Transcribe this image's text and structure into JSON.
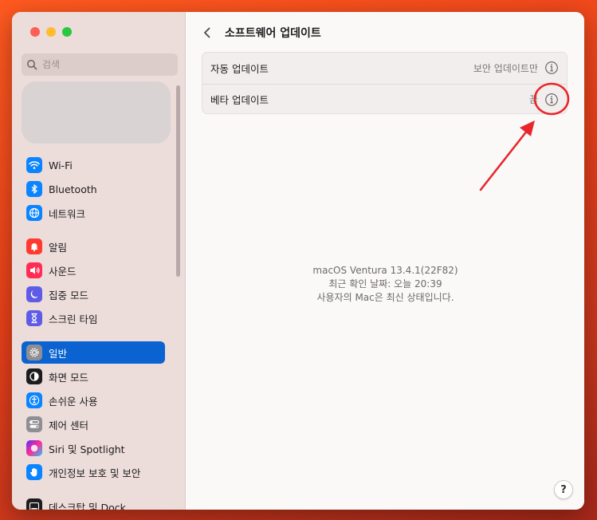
{
  "sidebar": {
    "search_placeholder": "검색",
    "items": [
      {
        "label": "Wi-Fi",
        "icon": "wifi-icon",
        "color": "#0a84ff"
      },
      {
        "label": "Bluetooth",
        "icon": "bluetooth-icon",
        "color": "#0a84ff"
      },
      {
        "label": "네트워크",
        "icon": "globe-icon",
        "color": "#0a84ff"
      },
      {
        "label": "알림",
        "icon": "bell-icon",
        "color": "#ff3b30"
      },
      {
        "label": "사운드",
        "icon": "speaker-icon",
        "color": "#ff2d55"
      },
      {
        "label": "집중 모드",
        "icon": "moon-icon",
        "color": "#5e5ce6"
      },
      {
        "label": "스크린 타임",
        "icon": "hourglass-icon",
        "color": "#5e5ce6"
      },
      {
        "label": "일반",
        "icon": "gear-icon",
        "color": "#8e8e93"
      },
      {
        "label": "화면 모드",
        "icon": "appearance-icon",
        "color": "#1c1c1e"
      },
      {
        "label": "손쉬운 사용",
        "icon": "accessibility-icon",
        "color": "#0a84ff"
      },
      {
        "label": "제어 센터",
        "icon": "control-center-icon",
        "color": "#8e8e93"
      },
      {
        "label": "Siri 및 Spotlight",
        "icon": "siri-icon",
        "color": "#2c2c2e"
      },
      {
        "label": "개인정보 보호 및 보안",
        "icon": "hand-icon",
        "color": "#0a84ff"
      },
      {
        "label": "데스크탑 및 Dock",
        "icon": "dock-icon",
        "color": "#1c1c1e"
      }
    ],
    "active_label": "일반"
  },
  "main": {
    "title": "소프트웨어 업데이트",
    "rows": [
      {
        "label": "자동 업데이트",
        "value": "보안 업데이트만"
      },
      {
        "label": "베타 업데이트",
        "value": "끔"
      }
    ],
    "info": {
      "version": "macOS Ventura 13.4.1(22F82)",
      "last_checked": "최근 확인 날짜: 오늘 20:39",
      "status": "사용자의 Mac은 최신 상태입니다."
    },
    "help_label": "?"
  },
  "colors": {
    "accent": "#0a63d1",
    "annotation": "#e8262b"
  }
}
